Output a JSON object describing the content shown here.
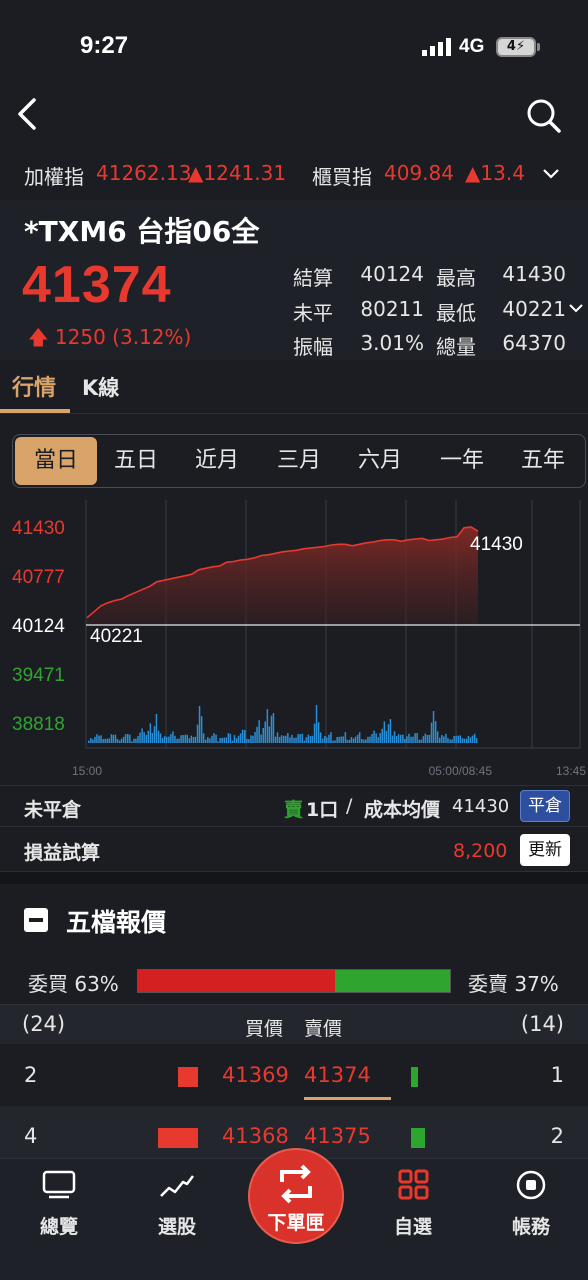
{
  "status_bar": {
    "time": "9:27",
    "network": "4G",
    "battery": "4"
  },
  "ticker": {
    "taiex_label": "加權指",
    "taiex_value": "41262.13",
    "taiex_change": "▲1241.31",
    "otc_label": "櫃買指",
    "otc_value": "409.84",
    "otc_change": "▲13.4"
  },
  "quote": {
    "symbol": "*TXM6 台指06全",
    "price": "41374",
    "change": "1250 (3.12%)",
    "stats": [
      {
        "label": "結算",
        "value": "40124",
        "label2": "最高",
        "value2": "41430"
      },
      {
        "label": "未平",
        "value": "80211",
        "label2": "最低",
        "value2": "40221"
      },
      {
        "label": "振幅",
        "value": "3.01%",
        "label2": "總量",
        "value2": "64370"
      }
    ]
  },
  "tabs": {
    "quote": "行情",
    "kline": "K線"
  },
  "periods": [
    "當日",
    "五日",
    "近月",
    "三月",
    "六月",
    "一年",
    "五年"
  ],
  "chart_data": {
    "type": "line",
    "y_ticks": [
      "41430",
      "40777",
      "40124",
      "39471",
      "38818"
    ],
    "x_ticks": [
      "15:00",
      "05:00/08:45",
      "13:45"
    ],
    "ylim": [
      38818,
      41430
    ],
    "reference": 40124,
    "high_label": "41430",
    "low_label": "40221",
    "colors": {
      "line": "#e8392f",
      "volume": "#2a8fd6",
      "up_tick": "#e8392f",
      "down_tick": "#2ea52e"
    },
    "price": [
      40221,
      40300,
      40380,
      40420,
      40450,
      40470,
      40520,
      40560,
      40600,
      40640,
      40700,
      40720,
      40740,
      40760,
      40780,
      40800,
      40860,
      40880,
      40900,
      40910,
      40960,
      40970,
      40990,
      41000,
      41020,
      41050,
      41060,
      41080,
      41100,
      41110,
      41120,
      41140,
      41150,
      41160,
      41170,
      41190,
      41200,
      41200,
      41180,
      41200,
      41220,
      41230,
      41250,
      41260,
      41260,
      41240,
      41260,
      41270,
      41280,
      41250,
      41260,
      41270,
      41290,
      41300,
      41420,
      41430,
      41374
    ]
  },
  "position": {
    "label": "未平倉",
    "side": "賣",
    "qty": "1口",
    "sep": "/",
    "cost_label": "成本均價",
    "cost": "41430",
    "close_button": "平倉"
  },
  "pnl": {
    "label": "損益試算",
    "value": "8,200",
    "refresh_button": "更新"
  },
  "orderbook": {
    "title": "五檔報價",
    "bid_ratio": "委買 63%",
    "ask_ratio": "委賣 37%",
    "bid_pct": 63,
    "header": {
      "bid_total": "(24)",
      "bid_price": "買價",
      "ask_price": "賣價",
      "ask_total": "(14)"
    },
    "rows": [
      {
        "bid_vol": "2",
        "bid": "41369",
        "ask": "41374",
        "ask_vol": "1",
        "bid_frac": 0.5,
        "ask_frac": 1.0
      },
      {
        "bid_vol": "4",
        "bid": "41368",
        "ask": "41375",
        "ask_vol": "2",
        "bid_frac": 1.0,
        "ask_frac": 2.0
      }
    ]
  },
  "bottom_nav": {
    "overview": "總覽",
    "screener": "選股",
    "order": "下單匣",
    "watchlist": "自選",
    "account": "帳務"
  }
}
